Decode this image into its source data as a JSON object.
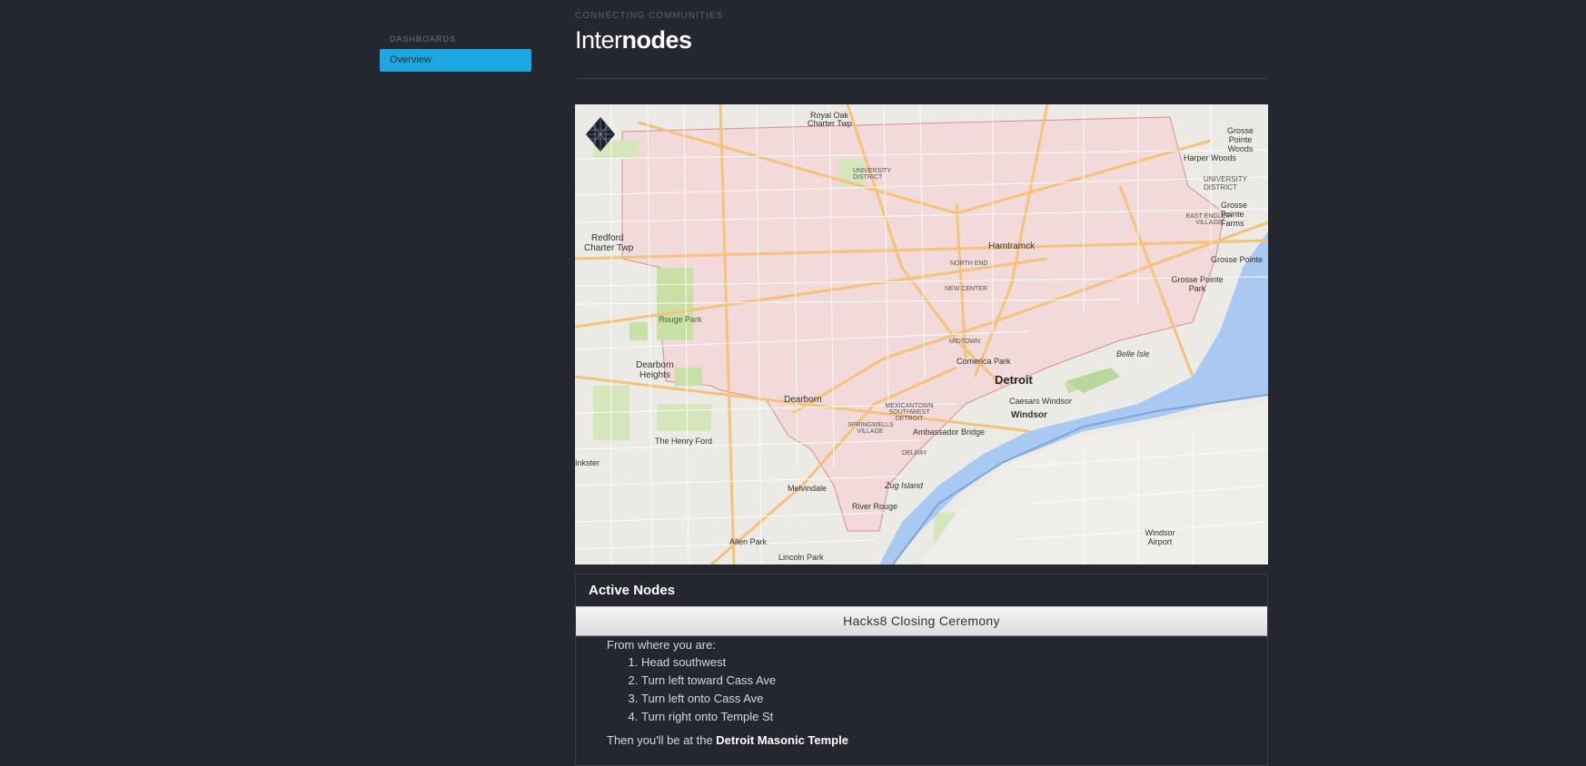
{
  "sidebar": {
    "heading": "DASHBOARDS",
    "items": [
      {
        "label": "Overview",
        "active": true
      }
    ]
  },
  "header": {
    "eyebrow": "CONNECTING COMMUNITIES",
    "title_light": "Inter",
    "title_bold": "nodes"
  },
  "map": {
    "labels": {
      "royal_oak": "Royal Oak",
      "charter_twp": "Charter Twp",
      "grosse_pointe_woods": "Grosse Pointe Woods",
      "harper_woods": "Harper Woods",
      "redford": "Redford",
      "redford_twp": "Charter Twp",
      "hamtramck": "Hamtramck",
      "east_english": "EAST ENGLISH VILLAGE",
      "grosse_pointe": "Grosse Pointe",
      "grosse_pointe_farms": "Grosse Pointe Farms",
      "grosse_pointe_park": "Grosse Pointe Park",
      "rouge_park": "Rouge Park",
      "dearborn_heights": "Dearborn Heights",
      "comerica": "Comerica Park",
      "detroit": "Detroit",
      "belle_isle": "Belle Isle",
      "caesars": "Caesars Windsor",
      "windsor": "Windsor",
      "dearborn": "Dearborn",
      "ambassador": "Ambassador Bridge",
      "henry_ford": "The Henry Ford",
      "melvindale": "Melvindale",
      "zug_island": "Zug Island",
      "river_rouge": "River Rouge",
      "allen_park": "Allen Park",
      "lincoln_park": "Lincoln Park",
      "windsor_airport": "Windsor Airport",
      "inkster": "Inkster",
      "university": "UNIVERSITY DISTRICT",
      "midtown": "MIDTOWN",
      "new_center": "NEW CENTER",
      "north_end": "NORTH END",
      "mexicantown": "MEXICANTOWN SOUTHWEST DETROIT",
      "delray": "DELRAY",
      "springwells": "SPRINGWELLS VILLAGE"
    }
  },
  "nodes": {
    "title": "Active Nodes",
    "active_node": "Hacks8 Closing Ceremony",
    "from_label": "From where you are:",
    "steps": [
      "Head southwest",
      "Turn left toward Cass Ave",
      "Turn left onto Cass Ave",
      "Turn right onto Temple St"
    ],
    "arrive_prefix": "Then you'll be at the ",
    "destination": "Detroit Masonic Temple"
  },
  "colors": {
    "background": "#242730",
    "accent": "#1ba8e0"
  }
}
